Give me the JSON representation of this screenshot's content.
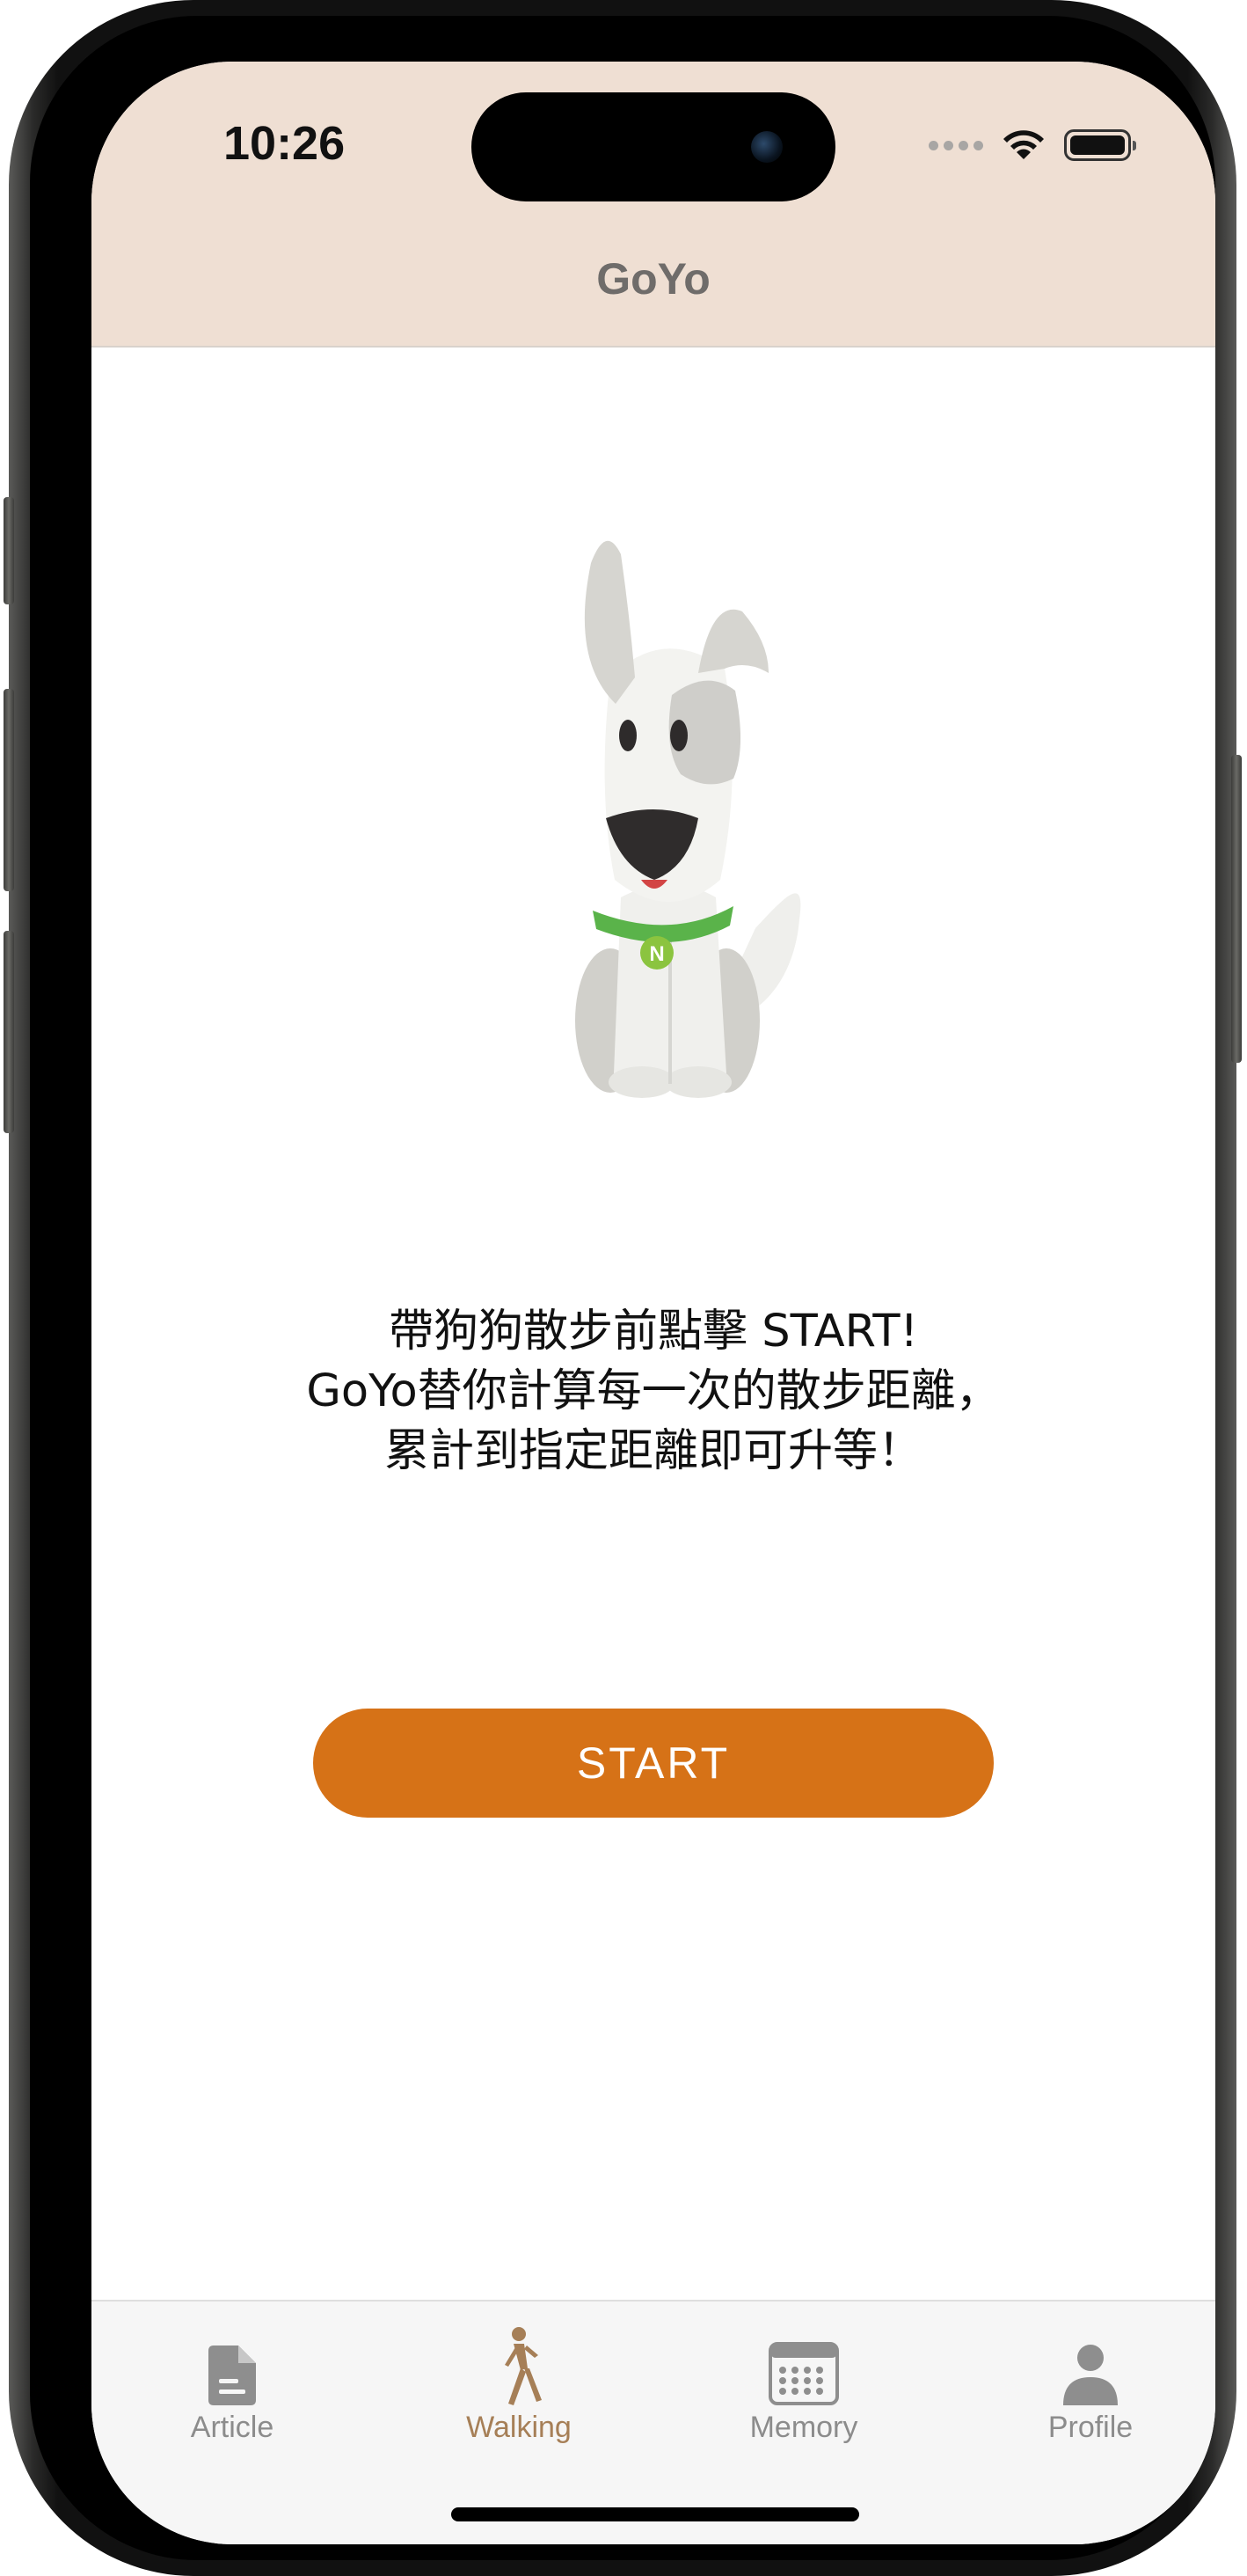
{
  "status_bar": {
    "time": "10:26"
  },
  "nav": {
    "title": "GoYo"
  },
  "main": {
    "illustration": "dog-illustration",
    "message_lines": [
      "帶狗狗散步前點擊 START!",
      "GoYo替你計算每一次的散步距離，",
      "累計到指定距離即可升等！"
    ],
    "start_button_label": "START"
  },
  "tabbar": {
    "tabs": [
      {
        "label": "Article",
        "icon": "document-icon",
        "active": false
      },
      {
        "label": "Walking",
        "icon": "walking-person-icon",
        "active": true
      },
      {
        "label": "Memory",
        "icon": "calendar-icon",
        "active": false
      },
      {
        "label": "Profile",
        "icon": "person-icon",
        "active": false
      }
    ]
  },
  "colors": {
    "header_bg": "#efdfd3",
    "accent": "#d67217",
    "tab_active": "#a67f57",
    "tab_inactive": "#8c8c8c"
  }
}
